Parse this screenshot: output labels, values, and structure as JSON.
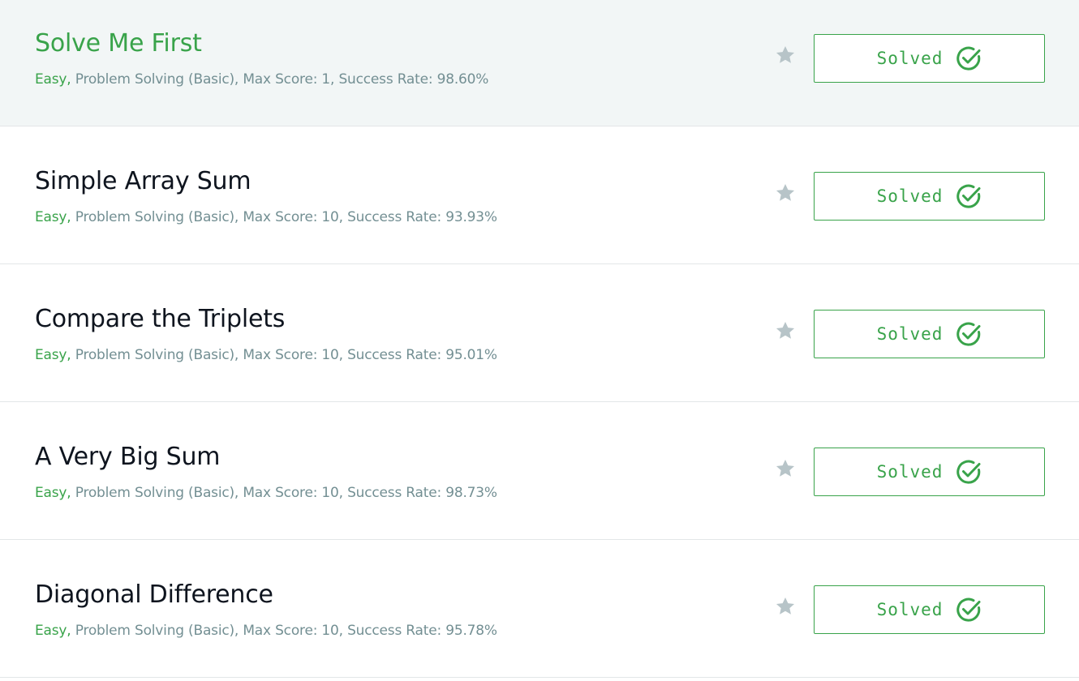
{
  "colors": {
    "accent_green": "#39a34a",
    "meta_gray": "#738f93",
    "star_gray": "#b7c4c8",
    "highlight_bg": "#f2f6f6",
    "title_dark": "#0e141e"
  },
  "challenges": [
    {
      "title": "Solve Me First",
      "difficulty": "Easy,",
      "details": " Problem Solving (Basic), Max Score: 1, Success Rate: 98.60%",
      "status_label": "Solved",
      "star_icon": "star-icon",
      "status_icon": "check-circle-icon",
      "highlighted": true
    },
    {
      "title": "Simple Array Sum",
      "difficulty": "Easy,",
      "details": " Problem Solving (Basic), Max Score: 10, Success Rate: 93.93%",
      "status_label": "Solved",
      "star_icon": "star-icon",
      "status_icon": "check-circle-icon",
      "highlighted": false
    },
    {
      "title": "Compare the Triplets",
      "difficulty": "Easy,",
      "details": " Problem Solving (Basic), Max Score: 10, Success Rate: 95.01%",
      "status_label": "Solved",
      "star_icon": "star-icon",
      "status_icon": "check-circle-icon",
      "highlighted": false
    },
    {
      "title": "A Very Big Sum",
      "difficulty": "Easy,",
      "details": " Problem Solving (Basic), Max Score: 10, Success Rate: 98.73%",
      "status_label": "Solved",
      "star_icon": "star-icon",
      "status_icon": "check-circle-icon",
      "highlighted": false
    },
    {
      "title": "Diagonal Difference",
      "difficulty": "Easy,",
      "details": " Problem Solving (Basic), Max Score: 10, Success Rate: 95.78%",
      "status_label": "Solved",
      "star_icon": "star-icon",
      "status_icon": "check-circle-icon",
      "highlighted": false
    }
  ]
}
